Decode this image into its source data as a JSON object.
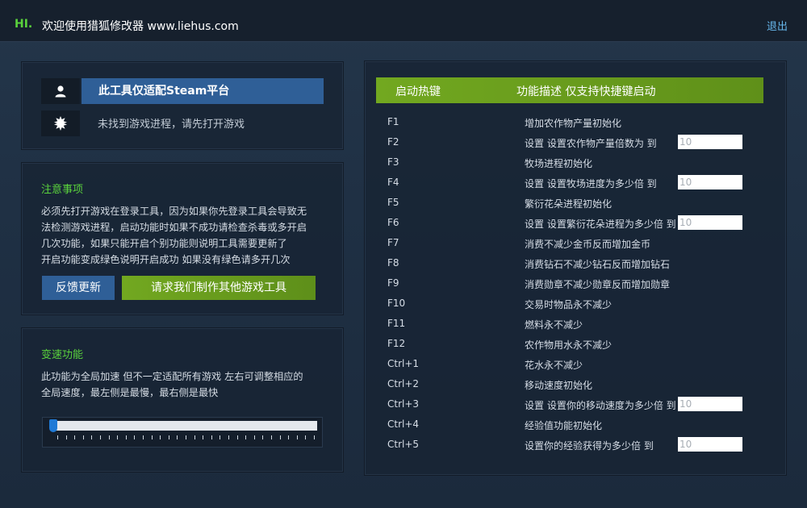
{
  "header": {
    "greeting": "HI.",
    "title": "欢迎使用猎狐修改器 www.liehus.com",
    "exit_label": "退出"
  },
  "status": {
    "platform_label": "此工具仅适配Steam平台",
    "process_label": "未找到游戏进程，请先打开游戏",
    "user_icon": "user-icon",
    "gear_icon": "gear-icon"
  },
  "notes": {
    "title": "注意事项",
    "lines": [
      "必须先打开游戏在登录工具，因为如果你先登录工具会导致无",
      "法检测游戏进程，启动功能时如果不成功请检查杀毒或多开启",
      "几次功能，如果只能开启个别功能则说明工具需要更新了",
      "开启功能变成绿色说明开启成功 如果没有绿色请多开几次"
    ],
    "feedback_button": "反馈更新",
    "request_button": "请求我们制作其他游戏工具"
  },
  "speed": {
    "title": "变速功能",
    "lines": [
      "此功能为全局加速 但不一定适配所有游戏 左右可调整相应的",
      "全局速度，最左侧是最慢，最右侧是最快"
    ],
    "slider_value": 0
  },
  "hotkeys": {
    "col_key": "启动热键",
    "col_desc": "功能描述 仅支持快捷键启动",
    "rows": [
      {
        "key": "F1",
        "desc": "增加农作物产量初始化",
        "input": null
      },
      {
        "key": "F2",
        "desc": "设置 设置农作物产量倍数为 到",
        "input": "10"
      },
      {
        "key": "F3",
        "desc": "牧场进程初始化",
        "input": null
      },
      {
        "key": "F4",
        "desc": "设置 设置牧场进度为多少倍 到",
        "input": "10"
      },
      {
        "key": "F5",
        "desc": "繁衍花朵进程初始化",
        "input": null
      },
      {
        "key": "F6",
        "desc": "设置 设置繁衍花朵进程为多少倍 到",
        "input": "10"
      },
      {
        "key": "F7",
        "desc": "消费不减少金币反而增加金币",
        "input": null
      },
      {
        "key": "F8",
        "desc": "消费钻石不减少钻石反而增加钻石",
        "input": null
      },
      {
        "key": "F9",
        "desc": "消费勋章不减少勋章反而增加勋章",
        "input": null
      },
      {
        "key": "F10",
        "desc": "交易时物品永不减少",
        "input": null
      },
      {
        "key": "F11",
        "desc": "燃料永不减少",
        "input": null
      },
      {
        "key": "F12",
        "desc": "农作物用水永不减少",
        "input": null
      },
      {
        "key": "Ctrl+1",
        "desc": "花水永不减少",
        "input": null
      },
      {
        "key": "Ctrl+2",
        "desc": "移动速度初始化",
        "input": null
      },
      {
        "key": "Ctrl+3",
        "desc": "设置 设置你的移动速度为多少倍 到",
        "input": "10"
      },
      {
        "key": "Ctrl+4",
        "desc": "经验值功能初始化",
        "input": null
      },
      {
        "key": "Ctrl+5",
        "desc": "设置你的经验获得为多少倍 到",
        "input": "10"
      }
    ]
  },
  "colors": {
    "accent_green": "#5ad23c",
    "button_blue": "#2f5f97",
    "header_green": "#6a9e1e",
    "link_blue": "#67b7ec"
  }
}
